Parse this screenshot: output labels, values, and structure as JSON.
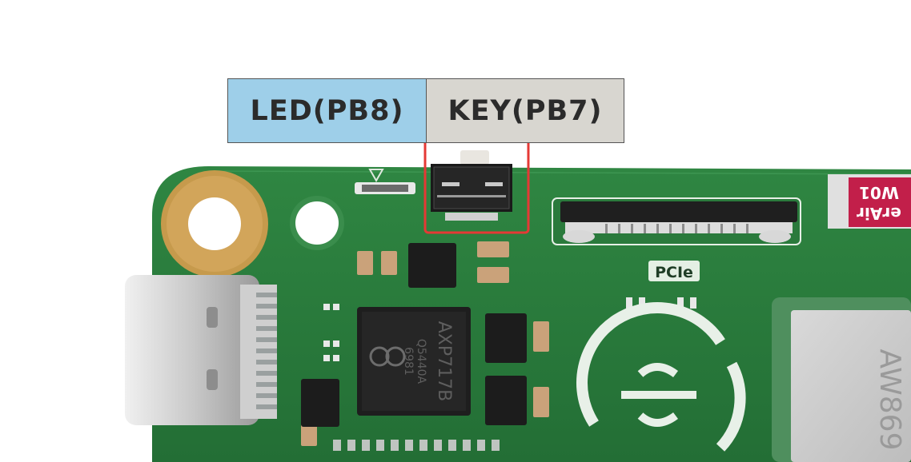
{
  "labels": {
    "led": "LED(PB8)",
    "key": "KEY(PB7)"
  },
  "board_text": {
    "pcie": "PCIe",
    "pmic_model": "AXP717B",
    "pmic_code1": "Q5440A",
    "pmic_code2": "6981",
    "module": "AW869",
    "sticker_line1": "W01",
    "sticker_line2": "erAir"
  },
  "colors": {
    "pcb": "#2a7a3c",
    "led_label_bg": "#9ecfe9",
    "key_label_bg": "#d8d6d0",
    "highlight": "#e53935"
  }
}
